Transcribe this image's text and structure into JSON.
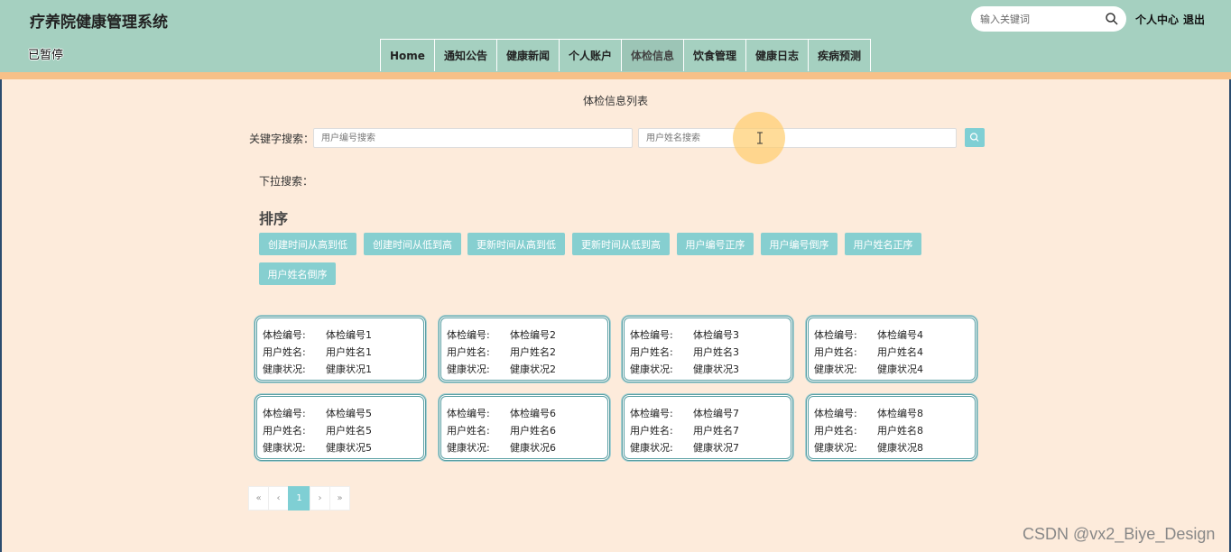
{
  "header": {
    "site_title": "疗养院健康管理系统",
    "paused_label": "已暂停",
    "search_placeholder": "输入关键词",
    "user_center": "个人中心",
    "logout": "退出"
  },
  "nav": {
    "items": [
      {
        "label": "Home"
      },
      {
        "label": "通知公告"
      },
      {
        "label": "健康新闻"
      },
      {
        "label": "个人账户"
      },
      {
        "label": "体检信息"
      },
      {
        "label": "饮食管理"
      },
      {
        "label": "健康日志"
      },
      {
        "label": "疾病预测"
      }
    ],
    "active": "体检信息"
  },
  "main": {
    "page_title": "体检信息列表",
    "keyword_label": "关键字搜索：",
    "user_no_placeholder": "用户编号搜索",
    "user_name_placeholder": "用户姓名搜索",
    "dropdown_label": "下拉搜索：",
    "sort_title": "排序",
    "sort_buttons": [
      "创建时间从高到低",
      "创建时间从低到高",
      "更新时间从高到低",
      "更新时间从低到高",
      "用户编号正序",
      "用户编号倒序",
      "用户姓名正序",
      "用户姓名倒序"
    ]
  },
  "cards": {
    "field_labels": {
      "no": "体检编号:",
      "name": "用户姓名:",
      "status": "健康状况:"
    },
    "items": [
      {
        "no": "体检编号1",
        "name": "用户姓名1",
        "status": "健康状况1"
      },
      {
        "no": "体检编号2",
        "name": "用户姓名2",
        "status": "健康状况2"
      },
      {
        "no": "体检编号3",
        "name": "用户姓名3",
        "status": "健康状况3"
      },
      {
        "no": "体检编号4",
        "name": "用户姓名4",
        "status": "健康状况4"
      },
      {
        "no": "体检编号5",
        "name": "用户姓名5",
        "status": "健康状况5"
      },
      {
        "no": "体检编号6",
        "name": "用户姓名6",
        "status": "健康状况6"
      },
      {
        "no": "体检编号7",
        "name": "用户姓名7",
        "status": "健康状况7"
      },
      {
        "no": "体检编号8",
        "name": "用户姓名8",
        "status": "健康状况8"
      }
    ]
  },
  "pagination": {
    "first": "«",
    "prev": "‹",
    "current": "1",
    "next": "›",
    "last": "»"
  },
  "watermark": "CSDN @vx2_Biye_Design",
  "colors": {
    "header_bg": "#a5d0c0",
    "stripe": "#f7c088",
    "page_bg": "#fdebdb",
    "accent": "#7fcfd4",
    "sort_btn": "#86cfd0",
    "card_border": "#5a9fa3"
  }
}
